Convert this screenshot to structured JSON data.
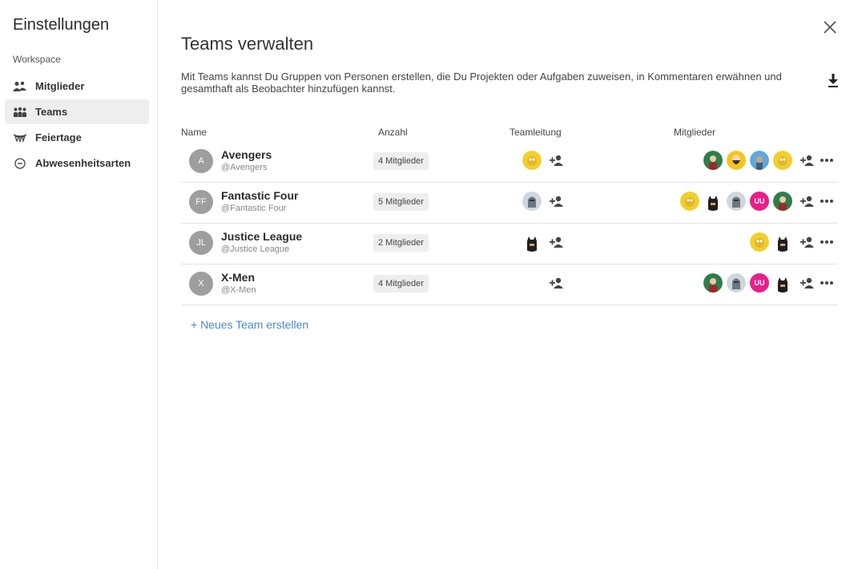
{
  "sidebar": {
    "title": "Einstellungen",
    "section": "Workspace",
    "items": [
      {
        "label": "Mitglieder",
        "icon": "people-icon"
      },
      {
        "label": "Teams",
        "icon": "team-icon"
      },
      {
        "label": "Feiertage",
        "icon": "garland-icon"
      },
      {
        "label": "Abwesenheitsarten",
        "icon": "minus-circle-icon"
      }
    ]
  },
  "page": {
    "title": "Teams verwalten",
    "description": "Mit Teams kannst Du Gruppen von Personen erstellen, die Du Projekten oder Aufgaben zuweisen, in Kommentaren erwähnen und gesamthaft als Beobachter hinzufügen kannst."
  },
  "table": {
    "headers": {
      "name": "Name",
      "count": "Anzahl",
      "lead": "Teamleitung",
      "members": "Mitglieder"
    },
    "rows": [
      {
        "initials": "A",
        "name": "Avengers",
        "handle": "@Avengers",
        "count": "4 Mitglieder"
      },
      {
        "initials": "FF",
        "name": "Fantastic Four",
        "handle": "@Fantastic Four",
        "count": "5 Mitglieder"
      },
      {
        "initials": "JL",
        "name": "Justice League",
        "handle": "@Justice League",
        "count": "2 Mitglieder"
      },
      {
        "initials": "X",
        "name": "X-Men",
        "handle": "@X-Men",
        "count": "4 Mitglieder"
      }
    ],
    "uu_initials": "UU"
  },
  "actions": {
    "new_team": "+ Neues Team erstellen"
  },
  "colors": {
    "accent": "#4a8ad0",
    "uu_avatar": "#e91e8a",
    "team_avatar": "#9e9e9e"
  }
}
